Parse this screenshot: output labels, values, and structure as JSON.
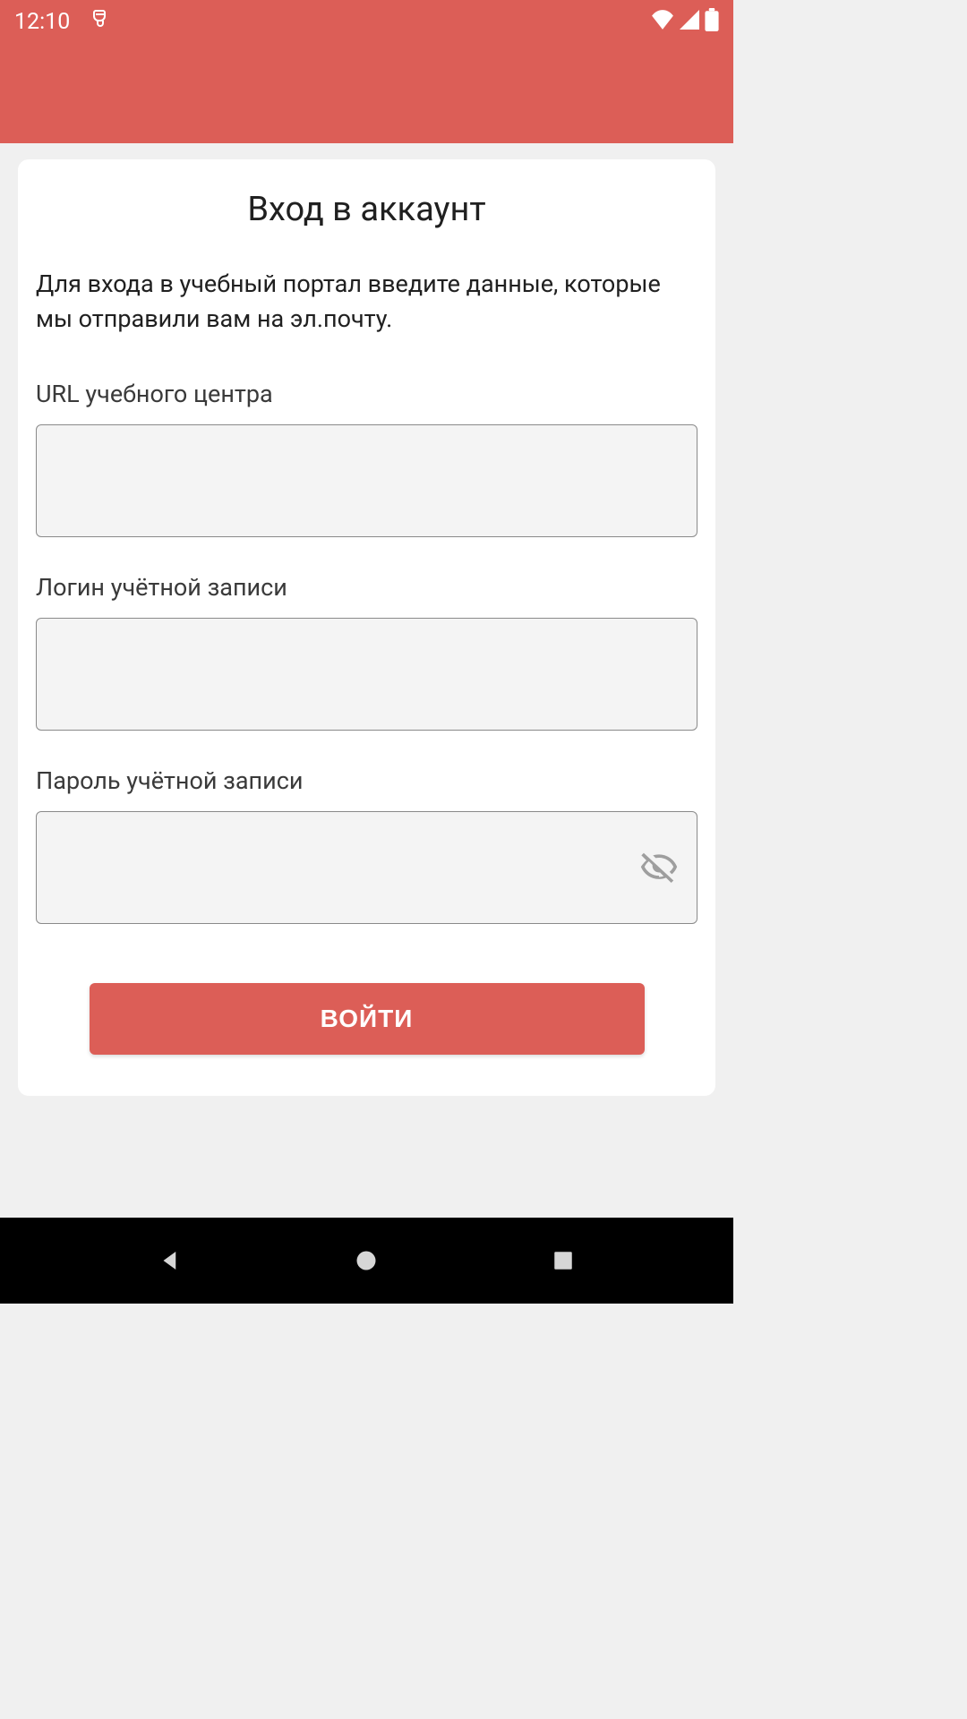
{
  "status_bar": {
    "time": "12:10"
  },
  "login": {
    "title": "Вход в аккаунт",
    "description": "Для входа в учебный портал введите данные, которые мы отправили вам на эл.почту.",
    "url_label": "URL учебного центра",
    "url_value": "",
    "login_label": "Логин учётной записи",
    "login_value": "",
    "password_label": "Пароль учётной записи",
    "password_value": "",
    "submit_label": "ВОЙТИ"
  },
  "icons": {
    "app_indicator": "app-indicator-icon",
    "wifi": "wifi-icon",
    "signal": "signal-icon",
    "battery": "battery-icon",
    "eye_off": "eye-off-icon",
    "nav_back": "nav-back-icon",
    "nav_home": "nav-home-icon",
    "nav_recent": "nav-recent-icon"
  },
  "colors": {
    "accent": "#DC5E57",
    "card_bg": "#ffffff",
    "page_bg": "#f0f0f0",
    "input_bg": "#f4f4f4",
    "input_border": "#8a8a8a",
    "nav_bg": "#000000"
  }
}
